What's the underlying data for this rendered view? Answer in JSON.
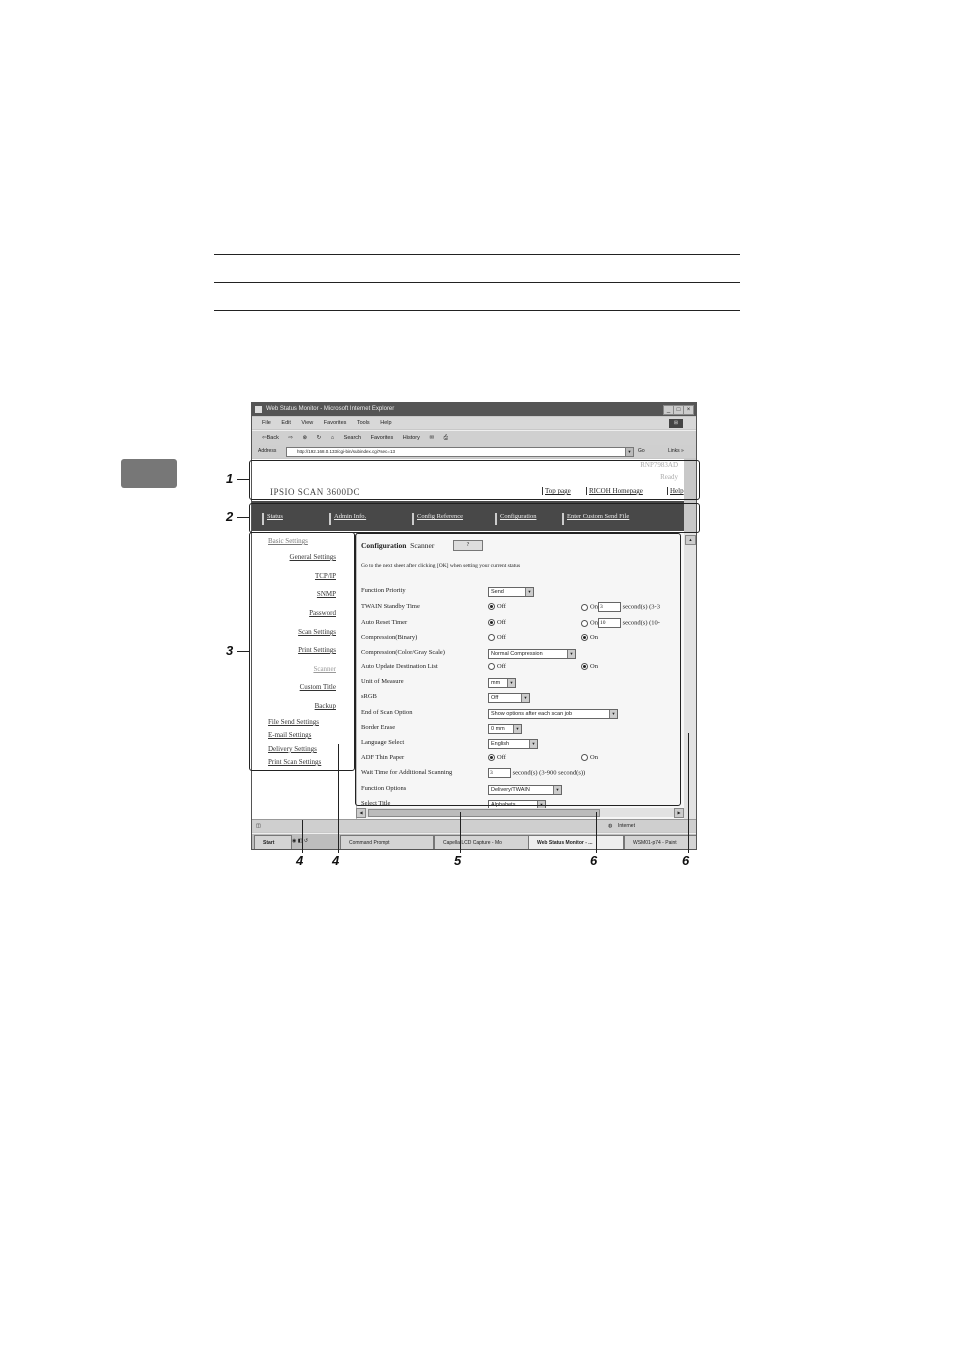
{
  "window": {
    "title": "Web Status Monitor - Microsoft Internet Explorer",
    "menu": [
      "File",
      "Edit",
      "View",
      "Favorites",
      "Tools",
      "Help"
    ],
    "toolbar": [
      "⇦Back",
      "⇨",
      "Search",
      "Favorites",
      "History"
    ],
    "address_label": "Address",
    "address_url": "http://192.168.0.133/cgi-bin/subindex.cgi?sec=13",
    "go_label": "Go",
    "links_label": "Links »"
  },
  "header": {
    "model_code": "RNP7983AD",
    "device_status": "Ready",
    "product_name": "IPSIO SCAN 3600DC",
    "links": [
      "Top page",
      "RICOH Homepage",
      "Help"
    ]
  },
  "nav": {
    "items": [
      "Status",
      "Admin Info.",
      "Config Reference",
      "Configuration",
      "Enter Custom Send File"
    ]
  },
  "sidebar": {
    "items": [
      "Basic Settings",
      "General Settings",
      "TCP/IP",
      "SNMP",
      "Password",
      "Scan Settings",
      "Print Settings",
      "Scanner",
      "Custom Title",
      "Backup",
      "File Send Settings",
      "E-mail Settings",
      "Delivery Settings",
      "Print Scan Settings"
    ]
  },
  "content": {
    "heading": "Configuration",
    "subheading": "Scanner",
    "help_button": "?",
    "instructions": "Go to the next sheet after clicking [OK] when setting your current status",
    "fields": {
      "function_priority": {
        "label": "Function Priority",
        "value": "Send"
      },
      "twain_standby": {
        "label": "TWAIN Standby Time",
        "off": "Off",
        "on": "On",
        "value": "3",
        "unit": "second(s)",
        "range": "(3-3"
      },
      "auto_reset": {
        "label": "Auto Reset Timer",
        "off": "Off",
        "on": "On",
        "value": "10",
        "unit": "second(s)",
        "range": "(10-"
      },
      "compression_binary": {
        "label": "Compression(Binary)",
        "off": "Off",
        "on": "On"
      },
      "compression_color": {
        "label": "Compression(Color/Gray Scale)",
        "value": "Normal Compression"
      },
      "auto_update": {
        "label": "Auto Update Destination List",
        "off": "Off",
        "on": "On"
      },
      "unit_of_measure": {
        "label": "Unit of Measure",
        "value": "mm"
      },
      "srgb": {
        "label": "sRGB",
        "value": "Off"
      },
      "end_of_scan": {
        "label": "End of Scan Option",
        "value": "Show options after each scan job"
      },
      "border_erase": {
        "label": "Border Erase",
        "value": "0 mm"
      },
      "language": {
        "label": "Language Select",
        "value": "English"
      },
      "adf_thin": {
        "label": "ADF Thin Paper",
        "off": "Off",
        "on": "On"
      },
      "wait_time": {
        "label": "Wait Time for Additional Scanning",
        "value": "3",
        "unit": "second(s)",
        "range": "(3-900 second(s))"
      },
      "function_options": {
        "label": "Function Options",
        "value": "Delivery/TWAIN"
      },
      "select_title": {
        "label": "Select Title",
        "value": "Alphabets"
      }
    }
  },
  "statusbar": {
    "zone": "Internet"
  },
  "taskbar": {
    "start": "Start",
    "tasks": [
      "Command Prompt",
      "Capella LCD Capture - Mo",
      "Web Status Monitor - ...",
      "WSM01-p74 - Paint"
    ]
  },
  "callouts": [
    "1",
    "2",
    "3",
    "4",
    "4",
    "5",
    "6",
    "6"
  ]
}
